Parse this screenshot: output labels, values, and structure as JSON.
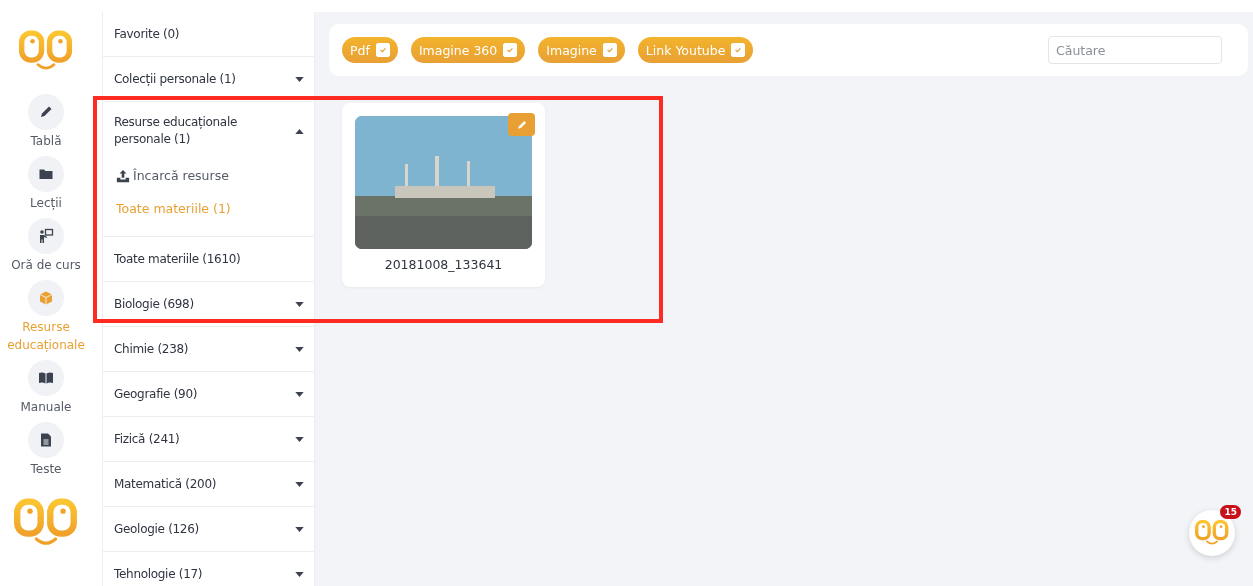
{
  "nav": [
    {
      "label": "Tablă",
      "selected": false
    },
    {
      "label": "Lecții",
      "selected": false
    },
    {
      "label": "Oră de curs",
      "selected": false
    },
    {
      "label": "Resurse educaționale",
      "selected": true
    },
    {
      "label": "Manuale",
      "selected": false
    },
    {
      "label": "Teste",
      "selected": false
    }
  ],
  "categories": [
    {
      "label": "Favorite (0)",
      "kind": "plain"
    },
    {
      "label": "Colecții personale (1)",
      "kind": "expandable",
      "expanded": false
    },
    {
      "label": "Resurse educaționale personale (1)",
      "kind": "expandable",
      "expanded": true,
      "children": [
        {
          "kind": "upload",
          "label": "Încarcă resurse",
          "selected": false
        },
        {
          "kind": "link",
          "label": "Toate materiile (1)",
          "selected": true
        }
      ]
    },
    {
      "label": "Toate materiile (1610)",
      "kind": "plain"
    },
    {
      "label": "Biologie (698)",
      "kind": "expandable",
      "expanded": false
    },
    {
      "label": "Chimie (238)",
      "kind": "expandable",
      "expanded": false
    },
    {
      "label": "Geografie (90)",
      "kind": "expandable",
      "expanded": false
    },
    {
      "label": "Fizică (241)",
      "kind": "expandable",
      "expanded": false
    },
    {
      "label": "Matematică (200)",
      "kind": "expandable",
      "expanded": false
    },
    {
      "label": "Geologie (126)",
      "kind": "expandable",
      "expanded": false
    },
    {
      "label": "Tehnologie (17)",
      "kind": "expandable",
      "expanded": false
    }
  ],
  "filters": [
    {
      "label": "Pdf",
      "checked": true
    },
    {
      "label": "Imagine 360",
      "checked": true
    },
    {
      "label": "Imagine",
      "checked": true
    },
    {
      "label": "Link Youtube",
      "checked": true
    }
  ],
  "search": {
    "placeholder": "Căutare"
  },
  "resources": [
    {
      "title": "20181008_133641"
    }
  ],
  "assistant": {
    "badge": "15"
  }
}
